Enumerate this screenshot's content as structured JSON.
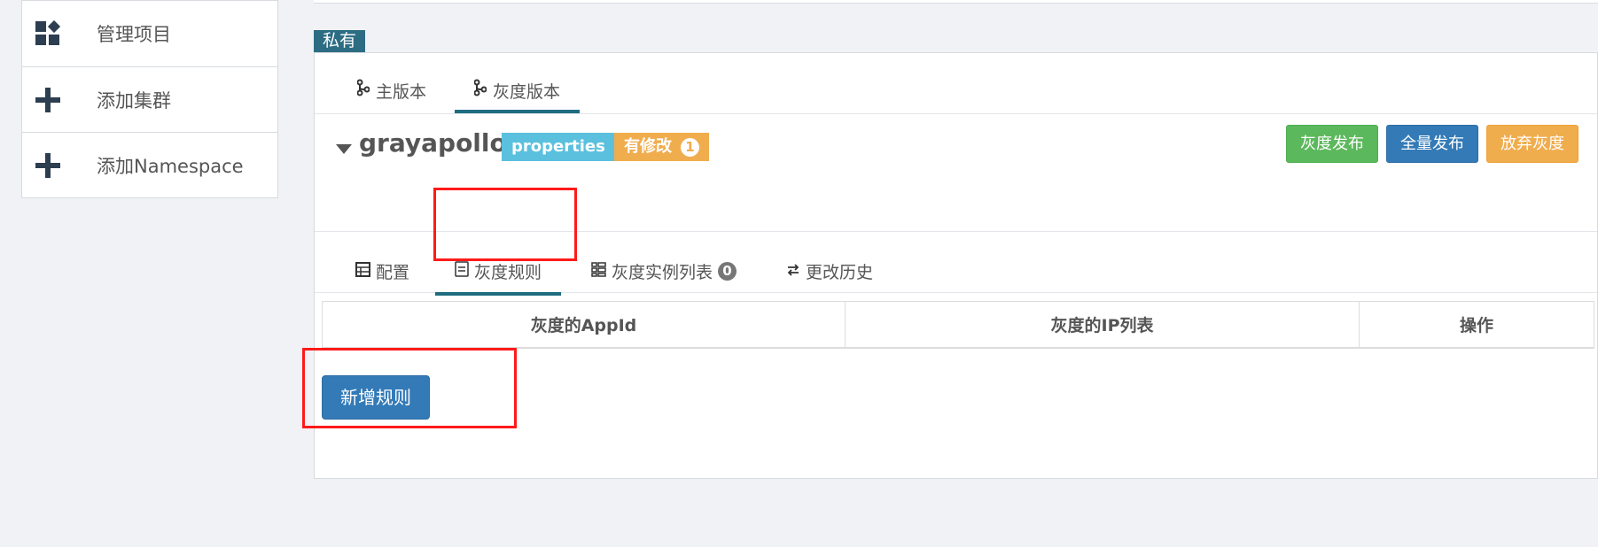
{
  "sidebar": {
    "items": [
      {
        "label": "管理项目",
        "icon": "dashboard-icon"
      },
      {
        "label": "添加集群",
        "icon": "plus-icon"
      },
      {
        "label": "添加Namespace",
        "icon": "plus-icon"
      }
    ]
  },
  "namespace": {
    "scope_badge": "私有",
    "version_tabs": [
      {
        "label": "主版本",
        "icon": "branch-icon"
      },
      {
        "label": "灰度版本",
        "icon": "branch-icon",
        "active": true
      }
    ],
    "name": "grayapollo",
    "format_badge": "properties",
    "modified_label": "有修改",
    "modified_count": "1",
    "actions": {
      "gray_release": "灰度发布",
      "full_release": "全量发布",
      "abandon_gray": "放弃灰度"
    },
    "sub_tabs": [
      {
        "label": "配置",
        "icon": "table-icon"
      },
      {
        "label": "灰度规则",
        "icon": "document-icon",
        "active": true
      },
      {
        "label": "灰度实例列表",
        "icon": "list-icon",
        "count": "0"
      },
      {
        "label": "更改历史",
        "icon": "swap-icon"
      }
    ],
    "rules_table": {
      "columns": [
        "灰度的AppId",
        "灰度的IP列表",
        "操作"
      ]
    },
    "add_rule_label": "新增规则"
  },
  "colors": {
    "accent": "#1e6d80",
    "primary": "#337ab7",
    "success": "#5cb85c",
    "warning": "#f0ad4e",
    "info": "#5bc0de",
    "highlight": "#ff1a1a"
  }
}
